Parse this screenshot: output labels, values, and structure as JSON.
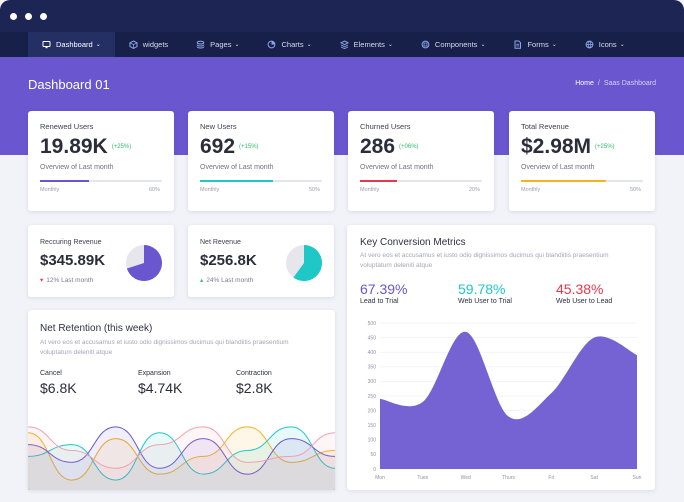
{
  "window": {
    "dots_color": "#ffffff"
  },
  "nav": {
    "items": [
      {
        "label": "Dashboard",
        "icon": "monitor-icon",
        "active": true,
        "dropdown": true
      },
      {
        "label": "widgets",
        "icon": "cube-icon",
        "active": false,
        "dropdown": false
      },
      {
        "label": "Pages",
        "icon": "layers-icon",
        "active": false,
        "dropdown": true
      },
      {
        "label": "Charts",
        "icon": "pie-chart-icon",
        "active": false,
        "dropdown": true
      },
      {
        "label": "Elements",
        "icon": "stack-icon",
        "active": false,
        "dropdown": true
      },
      {
        "label": "Components",
        "icon": "box-icon",
        "active": false,
        "dropdown": true
      },
      {
        "label": "Forms",
        "icon": "document-icon",
        "active": false,
        "dropdown": true
      },
      {
        "label": "Icons",
        "icon": "globe-icon",
        "active": false,
        "dropdown": true
      }
    ]
  },
  "header": {
    "title": "Dashboard 01",
    "breadcrumb_home": "Home",
    "breadcrumb_sep": "/",
    "breadcrumb_current": "Saas Dashboard"
  },
  "stats": [
    {
      "label": "Renewed Users",
      "value": "19.89K",
      "delta": "(+25%)",
      "sub": "Overview of Last month",
      "left": "Monthly",
      "right": "60%",
      "progress": 0.4,
      "color": "#6a56cf"
    },
    {
      "label": "New Users",
      "value": "692",
      "delta": "(+15%)",
      "sub": "Overview of Last month",
      "left": "Monthly",
      "right": "50%",
      "progress": 0.6,
      "color": "#1fc7c7"
    },
    {
      "label": "Churned Users",
      "value": "286",
      "delta": "(+06%)",
      "sub": "Overview of Last month",
      "left": "Monthly",
      "right": "20%",
      "progress": 0.3,
      "color": "#e5384f"
    },
    {
      "label": "Total Revenue",
      "value": "$2.98M",
      "delta": "(+25%)",
      "sub": "Overview of Last month",
      "left": "Monthly",
      "right": "50%",
      "progress": 0.7,
      "color": "#f5b31f"
    }
  ],
  "revenue_cards": [
    {
      "label": "Reccuring Revenue",
      "value": "$345.89K",
      "sub": "12% Last month",
      "arrow": "▾",
      "arrow_color": "#e5384f",
      "pie_fraction": 0.7,
      "pie_color": "#6a56cf"
    },
    {
      "label": "Net Revenue",
      "value": "$256.8K",
      "sub": "24% Last month",
      "arrow": "▴",
      "arrow_color": "#2fbf6b",
      "pie_fraction": 0.6,
      "pie_color": "#1fc7c7"
    }
  ],
  "retention": {
    "title": "Net Retention (this week)",
    "description": "At vero eos et accusamus et iusto odio dignissimos ducimus qui blandiitis praesentium voluptatum deleniti atque",
    "items": [
      {
        "label": "Cancel",
        "value": "$6.8K"
      },
      {
        "label": "Expansion",
        "value": "$4.74K"
      },
      {
        "label": "Contraction",
        "value": "$2.8K"
      }
    ],
    "series_colors": [
      "#f5b31f",
      "#1fc7c7",
      "#6a56cf",
      "#f2a0b0"
    ]
  },
  "conversion": {
    "title": "Key Conversion Metrics",
    "description": "At vero eos et accusamus et iusto odio dignissimos ducimus qui blandiitis praesentium voluptatum deleniti atque",
    "metrics": [
      {
        "value": "67.39%",
        "label": "Lead to Trial",
        "color": "#6a56cf"
      },
      {
        "value": "59.78%",
        "label": "Web User to Trial",
        "color": "#1fc7c7"
      },
      {
        "value": "45.38%",
        "label": "Web User to Lead",
        "color": "#e5384f"
      }
    ]
  },
  "chart_data": [
    {
      "type": "area",
      "title": "",
      "categories": [
        "Mon",
        "Tues",
        "Wed",
        "Thurs",
        "Fri",
        "Sat",
        "Sun"
      ],
      "y_ticks": [
        "0",
        "50",
        "100",
        "150",
        "200",
        "250",
        "300",
        "350",
        "400",
        "450",
        "500"
      ],
      "ylim": [
        0,
        500
      ],
      "series": [
        {
          "values": [
            240,
            230,
            470,
            180,
            260,
            450,
            390
          ]
        }
      ],
      "color": "#6a56cf",
      "grid": true
    },
    {
      "type": "line",
      "title": "",
      "series": [
        {
          "values": [
            15,
            55,
            20,
            50,
            35,
            10,
            40,
            30
          ]
        },
        {
          "values": [
            35,
            25,
            55,
            15,
            50,
            30,
            10,
            45
          ]
        },
        {
          "values": [
            25,
            40,
            10,
            45,
            20,
            50,
            20,
            35
          ]
        },
        {
          "values": [
            10,
            30,
            45,
            25,
            10,
            40,
            35,
            15
          ]
        }
      ]
    }
  ]
}
